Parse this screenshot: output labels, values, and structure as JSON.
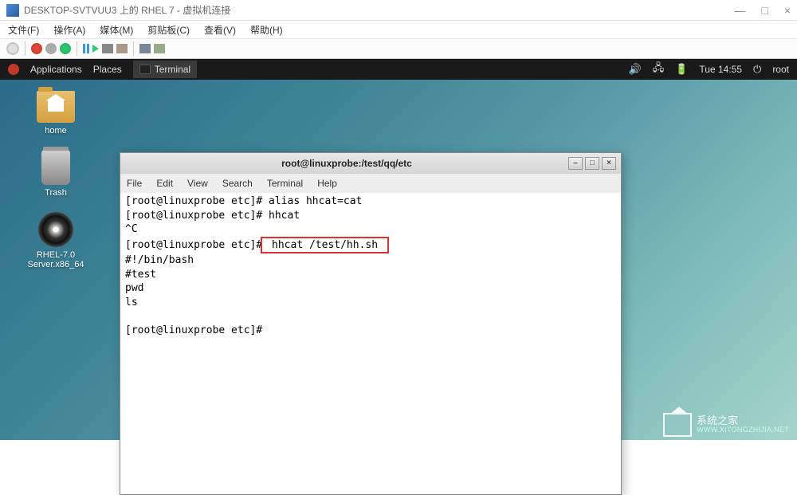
{
  "hyperv": {
    "title": "DESKTOP-SVTVUU3 上的 RHEL 7 - 虚拟机连接",
    "controls": {
      "min": "—",
      "max": "□",
      "close": "×"
    },
    "menu": [
      "文件(F)",
      "操作(A)",
      "媒体(M)",
      "剪贴板(C)",
      "查看(V)",
      "帮助(H)"
    ]
  },
  "gnome": {
    "apps": "Applications",
    "places": "Places",
    "active": "Terminal",
    "time": "Tue 14:55",
    "user": "root"
  },
  "desktop": {
    "home": "home",
    "trash": "Trash",
    "disc": "RHEL-7.0 Server.x86_64"
  },
  "terminal": {
    "title": "root@linuxprobe:/test/qq/etc",
    "menu": [
      "File",
      "Edit",
      "View",
      "Search",
      "Terminal",
      "Help"
    ],
    "lines": {
      "l1": "[root@linuxprobe etc]# alias hhcat=cat",
      "l2": "[root@linuxprobe etc]# hhcat",
      "l3": "^C",
      "l4_prompt": "[root@linuxprobe etc]#",
      "l4_cmd": " hhcat /test/hh.sh ",
      "l5": "#!/bin/bash",
      "l6": "#test",
      "l7": "pwd",
      "l8": "ls",
      "l9": "",
      "l10": "[root@linuxprobe etc]# "
    },
    "btns": {
      "min": "–",
      "max": "□",
      "close": "×"
    }
  },
  "watermark": {
    "name": "系统之家",
    "url": "WWW.XITONGZHIJIA.NET"
  }
}
